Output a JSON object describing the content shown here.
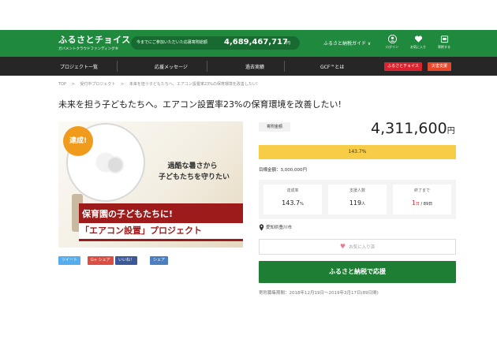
{
  "header": {
    "logo_title": "ふるさとチョイス",
    "logo_sub": "ガバメントクラウドファンディング®",
    "total_label": "今までにご参加いただいた応募寄附総額",
    "total_amount": "4,689,467,717",
    "total_unit": "円",
    "guide": "ふるさと納税ガイド ∨",
    "icons": [
      {
        "name": "login",
        "label": "ログイン"
      },
      {
        "name": "favorites",
        "label": "お気に入り"
      },
      {
        "name": "register",
        "label": "寄附する"
      }
    ]
  },
  "nav": {
    "items": [
      "プロジェクト一覧",
      "応援メッセージ",
      "過去実績",
      "GCF™とは"
    ],
    "btn_choice": "ふるさとチョイス",
    "btn_disaster": "災害支援"
  },
  "breadcrumb": [
    "TOP",
    ">",
    "受付中プロジェクト",
    ">",
    "未来を担う子どもたちへ。エアコン設置率23%の保育環境を改善したい!"
  ],
  "project": {
    "title": "未来を担う子どもたちへ。エアコン設置率23%の保育環境を改善したい!",
    "hero_badge": "達成!",
    "hero_line1": "過酷な暑さから",
    "hero_line2": "子どもたちを守りたい",
    "hero_banner1": "保育園の子どもたちに!",
    "hero_banner2": "「エアコン設置」プロジェクト",
    "donation_label": "寄附金額",
    "donation_amount": "4,311,600",
    "donation_unit": "円",
    "progress_text": "143.7%",
    "progress_fraction": 1.0,
    "goal": "目標金額：3,000,000円",
    "stats": {
      "rate_label": "達成率",
      "rate_value": "143.7",
      "rate_unit": "%",
      "supporters_label": "支援人数",
      "supporters_value": "119",
      "supporters_unit": "人",
      "remaining_label": "終了まで",
      "remaining_value": "1",
      "remaining_unit": "日",
      "remaining_total": " / 89日"
    },
    "location": "愛知県豊川市",
    "favorite_label": "お気に入り済",
    "cta_label": "ふるさと納税で応援",
    "period": "寄附募集期間：2018年12月19日～2019年3月17日(89日間)"
  },
  "share": [
    {
      "label": "ツイート",
      "color": "#55acee"
    },
    {
      "label": "G+ シェア",
      "color": "#dc4e41"
    },
    {
      "label": "いいね！",
      "color": "#3b5998"
    },
    {
      "label": "シェア",
      "color": "#4b7fc0"
    }
  ]
}
